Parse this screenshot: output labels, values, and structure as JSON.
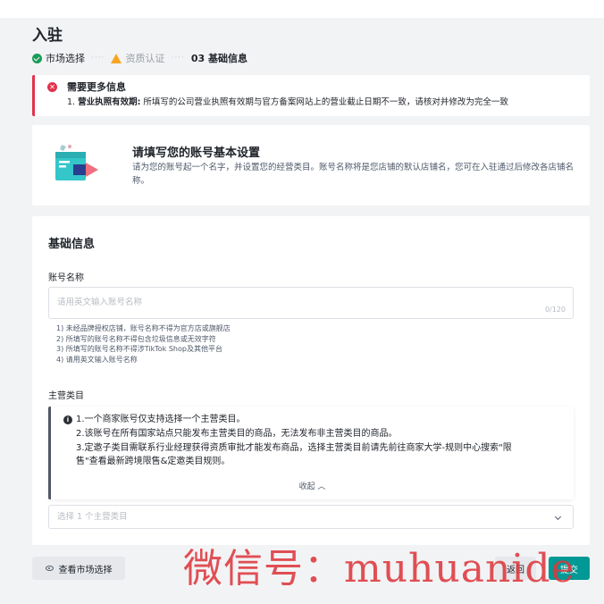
{
  "page": {
    "title": "入驻"
  },
  "steps": [
    {
      "label": "市场选择",
      "state": "done"
    },
    {
      "label": "资质认证",
      "state": "warning"
    },
    {
      "label": "03 基础信息",
      "state": "current"
    }
  ],
  "step_separator": "····",
  "alert": {
    "title": "需要更多信息",
    "item_prefix": "1. ",
    "item_bold": "营业执照有效期:",
    "item_text": " 所填写的公司营业执照有效期与官方备案网站上的营业截止日期不一致，请核对并修改为完全一致"
  },
  "intro": {
    "title": "请填写您的账号基本设置",
    "description": "请为您的账号起一个名字，并设置您的经营类目。账号名称将是您店铺的默认店铺名，您可在入驻通过后修改各店铺名称。"
  },
  "form": {
    "section_title": "基础信息",
    "account_name": {
      "label": "账号名称",
      "placeholder": "请用英文输入账号名称",
      "counter": "0/120",
      "rules": [
        "1) 未经品牌授权店铺，账号名称不得为官方店或旗舰店",
        "2) 所填写的账号名称不得包含垃圾信息或无效字符",
        "3) 所填写的账号名称不得涉TikTok Shop及其他平台",
        "4) 请用英文输入账号名称"
      ]
    },
    "main_category": {
      "label": "主营类目",
      "notice_lines": [
        "1.一个商家账号仅支持选择一个主营类目。",
        "2.该账号在所有国家站点只能发布主营类目的商品，无法发布非主营类目的商品。",
        "3.定邀子类目需联系行业经理获得资质审批才能发布商品，选择主营类目前请先前往商家大学-规则中心搜索\"限",
        "售\"查看最新跨境限售&定邀类目规则。"
      ],
      "collapse_label": "收起 ︿",
      "placeholder": "选择 1 个主营类目"
    }
  },
  "footer": {
    "view_market_label": "查看市场选择",
    "back_label": "返回",
    "submit_label": "提交"
  },
  "watermark": "微信号：muhuanide",
  "colors": {
    "primary": "#009995",
    "error": "#e0334b",
    "success": "#1c9b5a",
    "warning": "#f5a623"
  }
}
